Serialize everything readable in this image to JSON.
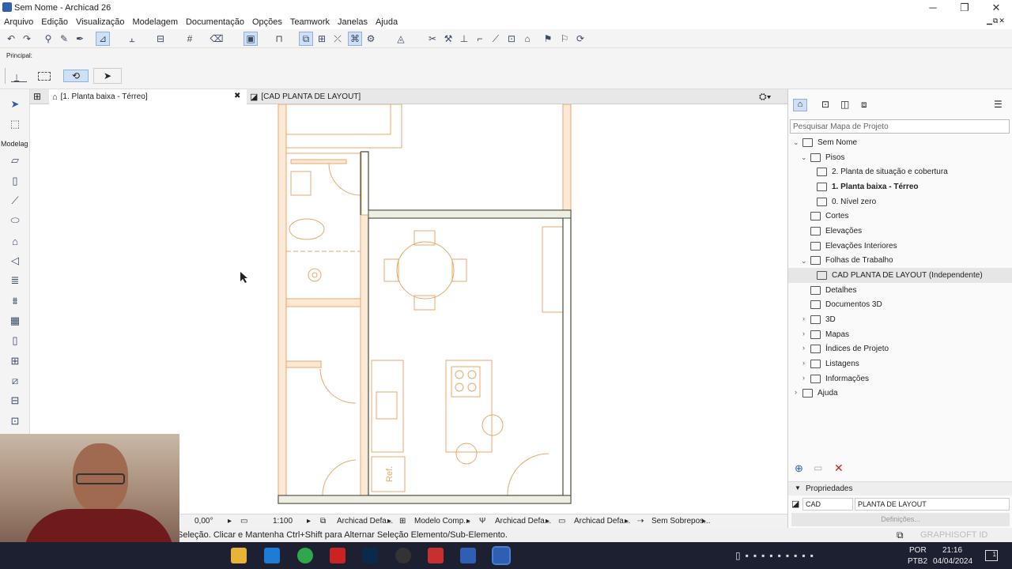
{
  "window": {
    "title": "Sem Nome - Archicad 26",
    "min_glyph": "─",
    "max_glyph": "❐",
    "close_glyph": "✕",
    "doc_controls": "▁⧉✕"
  },
  "menu": [
    "Arquivo",
    "Edição",
    "Visualização",
    "Modelagem",
    "Documentação",
    "Opções",
    "Teamwork",
    "Janelas",
    "Ajuda"
  ],
  "infobox": {
    "label": "Principal:"
  },
  "toolbox": {
    "section_label": "Modelag"
  },
  "tabs": [
    {
      "label": "[1. Planta baixa - Térreo]",
      "close": "✖"
    },
    {
      "label": "[CAD PLANTA DE LAYOUT]"
    }
  ],
  "canvas": {
    "ref_label": "Ref."
  },
  "statusbar": {
    "angle": "0,00°",
    "scale": "1:100",
    "layer": "Archicad Defa...",
    "model": "Modelo Comp...",
    "pen": "Archicad Defa...",
    "dim": "Archicad Defa...",
    "override": "Sem Sobrepos..."
  },
  "hint": "Seleção. Clicar e Mantenha Ctrl+Shift para Alternar Seleção Elemento/Sub-Elemento.",
  "navigator": {
    "search_placeholder": "Pesquisar Mapa de Projeto",
    "items": [
      {
        "label": "Sem Nome",
        "bold": false
      },
      {
        "label": "Pisos",
        "bold": false
      },
      {
        "label": "2. Planta de situação e cobertura",
        "bold": false
      },
      {
        "label": "1. Planta baixa - Térreo",
        "bold": true
      },
      {
        "label": "0. Nível zero",
        "bold": false
      },
      {
        "label": "Cortes",
        "bold": false
      },
      {
        "label": "Elevações",
        "bold": false
      },
      {
        "label": "Elevações Interiores",
        "bold": false
      },
      {
        "label": "Folhas de Trabalho",
        "bold": false
      },
      {
        "label": "CAD PLANTA DE LAYOUT (Independente)",
        "bold": false
      },
      {
        "label": "Detalhes",
        "bold": false
      },
      {
        "label": "Documentos 3D",
        "bold": false
      },
      {
        "label": "3D",
        "bold": false
      },
      {
        "label": "Mapas",
        "bold": false
      },
      {
        "label": "Índices de Projeto",
        "bold": false
      },
      {
        "label": "Listagens",
        "bold": false
      },
      {
        "label": "Informações",
        "bold": false
      },
      {
        "label": "Ajuda",
        "bold": false
      }
    ],
    "properties_label": "Propriedades",
    "prop_id": "CAD",
    "prop_name": "PLANTA DE LAYOUT",
    "settings_button": "Definições...",
    "graphisoft_label": "GRAPHISOFT ID"
  },
  "taskbar": {
    "lang1": "POR",
    "lang2": "PTB2",
    "time": "21:16",
    "date": "04/04/2024",
    "notif_count": "1"
  },
  "colors": {
    "plan_line": "#e8a868",
    "wall_dark": "#4a4a3a",
    "accent": "#2f5fb3"
  }
}
